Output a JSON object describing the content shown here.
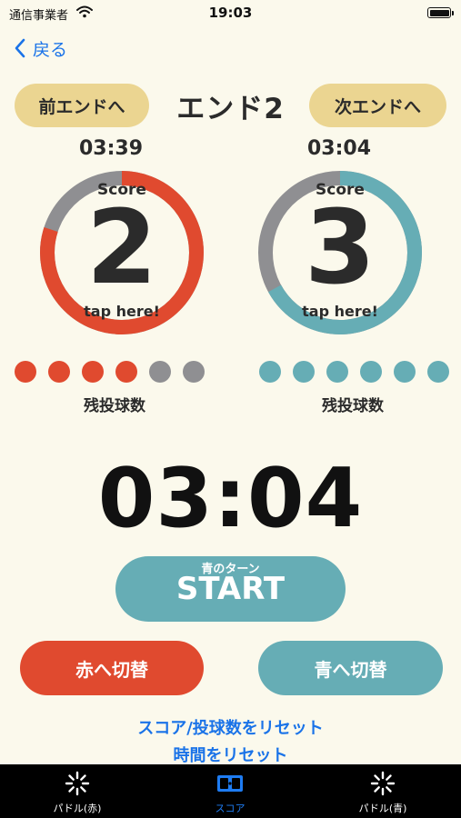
{
  "status": {
    "carrier": "通信事業者",
    "time": "19:03"
  },
  "nav": {
    "back_label": "戻る"
  },
  "end": {
    "prev_label": "前エンドへ",
    "title": "エンド2",
    "next_label": "次エンドへ"
  },
  "red": {
    "time": "03:39",
    "score_label": "Score",
    "score": "2",
    "tap_label": "tap here!",
    "timer_fraction": 0.8,
    "color": "#e04a2f",
    "balls_remaining": 4,
    "balls_total": 6,
    "remaining_label": "残投球数"
  },
  "blue": {
    "time": "03:04",
    "score_label": "Score",
    "score": "3",
    "tap_label": "tap here!",
    "timer_fraction": 0.67,
    "color": "#66adb5",
    "balls_remaining": 6,
    "balls_total": 6,
    "remaining_label": "残投球数"
  },
  "colors": {
    "inactive": "#8f8f92",
    "accent_pill": "#ebd591",
    "link": "#1a73e8"
  },
  "main_timer": "03:04",
  "start": {
    "turn_label": "青のターン",
    "label": "START"
  },
  "switch": {
    "to_red": "赤へ切替",
    "to_blue": "青へ切替"
  },
  "links": {
    "reset_score": "スコア/投球数をリセット",
    "reset_time": "時間をリセット"
  },
  "tabs": [
    {
      "label": "パドル(赤)",
      "icon": "loading-spinner-icon"
    },
    {
      "label": "スコア",
      "icon": "scoreboard-icon"
    },
    {
      "label": "パドル(青)",
      "icon": "loading-spinner-icon"
    }
  ]
}
